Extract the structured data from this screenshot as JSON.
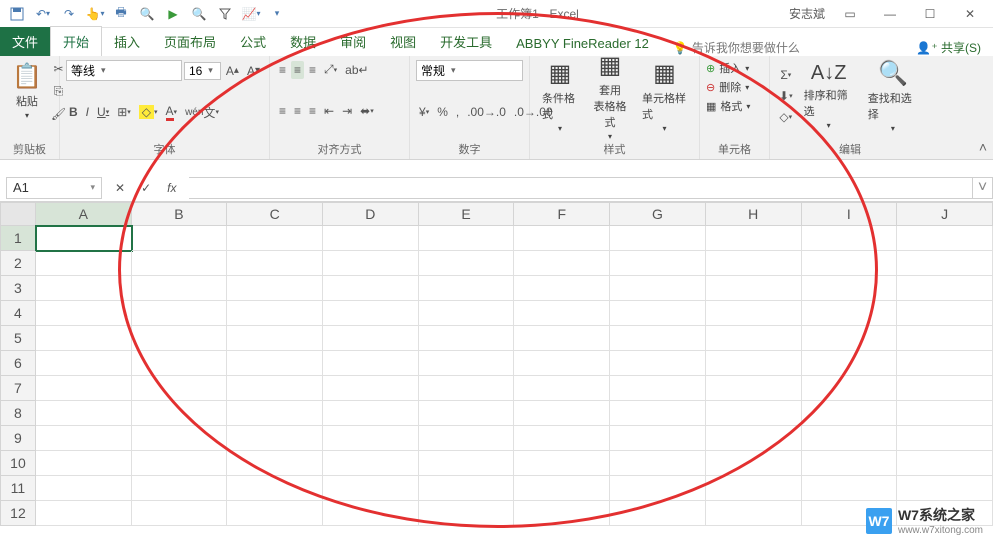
{
  "title": {
    "docname": "工作簿1",
    "app": "Excel",
    "user": "安志斌"
  },
  "qat": {
    "save": "💾",
    "undo": "↶",
    "redo": "↷"
  },
  "tabs": {
    "file": "文件",
    "items": [
      "开始",
      "插入",
      "页面布局",
      "公式",
      "数据",
      "审阅",
      "视图",
      "开发工具",
      "ABBYY FineReader 12"
    ],
    "tellme_placeholder": "告诉我你想要做什么",
    "share": "共享(S)"
  },
  "ribbon": {
    "clipboard": {
      "paste": "粘贴",
      "label": "剪贴板"
    },
    "font": {
      "name": "等线",
      "size": "16",
      "bold": "B",
      "italic": "I",
      "underline": "U",
      "label": "字体"
    },
    "align": {
      "wrap": "自动换行",
      "merge": "合并后居中",
      "label": "对齐方式"
    },
    "number": {
      "format": "常规",
      "percent": "%",
      "comma": ",",
      "label": "数字"
    },
    "styles": {
      "condfmt": "条件格式",
      "table": "套用\n表格格式",
      "cellstyle": "单元格样式",
      "label": "样式"
    },
    "cells": {
      "insert": "插入",
      "delete": "删除",
      "format": "格式",
      "label": "单元格"
    },
    "editing": {
      "sort": "排序和筛选",
      "find": "查找和选择",
      "label": "编辑"
    }
  },
  "formula": {
    "namebox": "A1",
    "fx": "fx"
  },
  "grid": {
    "cols": [
      "A",
      "B",
      "C",
      "D",
      "E",
      "F",
      "G",
      "H",
      "I",
      "J"
    ],
    "rows": [
      "1",
      "2",
      "3",
      "4",
      "5",
      "6",
      "7",
      "8",
      "9",
      "10",
      "11",
      "12"
    ],
    "selected": "A1"
  },
  "watermark": {
    "logo": "W7",
    "text": "W7系统之家",
    "url": "www.w7xitong.com"
  }
}
